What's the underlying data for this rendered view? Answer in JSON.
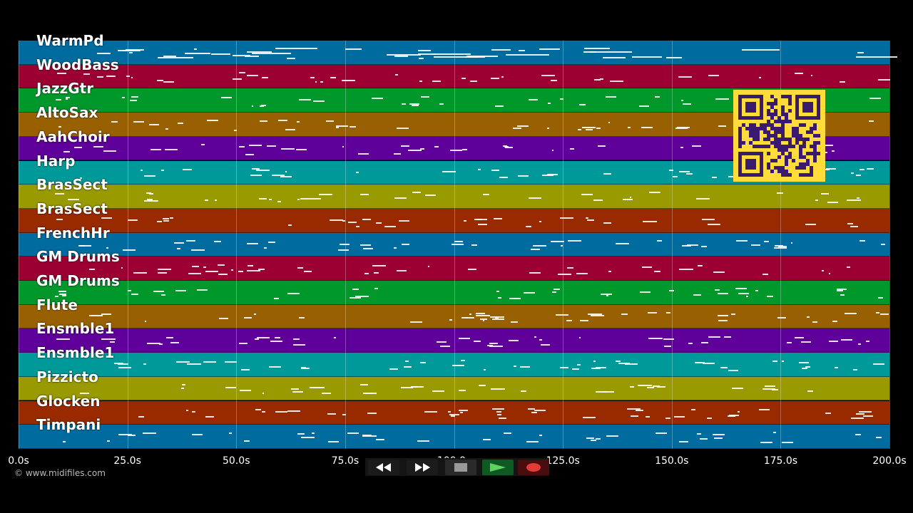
{
  "app": {
    "copyright": "© www.midifiles.com"
  },
  "tracks": [
    {
      "name": "WarmPd",
      "color": "#006b9e"
    },
    {
      "name": "WoodBass",
      "color": "#9c0033"
    },
    {
      "name": "JazzGtr",
      "color": "#00972b"
    },
    {
      "name": "AltoSax",
      "color": "#996000"
    },
    {
      "name": "AahChoir",
      "color": "#5e0099"
    },
    {
      "name": "Harp",
      "color": "#00999a"
    },
    {
      "name": "BrasSect",
      "color": "#999900"
    },
    {
      "name": "BrasSect",
      "color": "#992a00"
    },
    {
      "name": "FrenchHr",
      "color": "#006b9e"
    },
    {
      "name": "GM Drums",
      "color": "#9c0033"
    },
    {
      "name": "GM Drums",
      "color": "#00972b"
    },
    {
      "name": "Flute",
      "color": "#996000"
    },
    {
      "name": "Ensmble1",
      "color": "#5e0099"
    },
    {
      "name": "Ensmble1",
      "color": "#00999a"
    },
    {
      "name": "Pizzicto",
      "color": "#999900"
    },
    {
      "name": "Glocken",
      "color": "#992a00"
    },
    {
      "name": "Timpani",
      "color": "#006b9e"
    }
  ],
  "timeline": {
    "ticks": [
      "0.0s",
      "25.0s",
      "50.0s",
      "75.0s",
      "100.0s",
      "125.0s",
      "150.0s",
      "175.0s",
      "200.0s"
    ]
  },
  "transport": {
    "buttons": [
      {
        "name": "rewind-button",
        "icon": "rewind-icon"
      },
      {
        "name": "fast-forward-button",
        "icon": "fast-forward-icon"
      },
      {
        "name": "stop-button",
        "icon": "stop-icon"
      },
      {
        "name": "play-button",
        "icon": "play-icon"
      },
      {
        "name": "record-button",
        "icon": "record-icon"
      }
    ]
  },
  "badge": {
    "icon": "qr-code-icon",
    "color": "#ffdc3a"
  }
}
